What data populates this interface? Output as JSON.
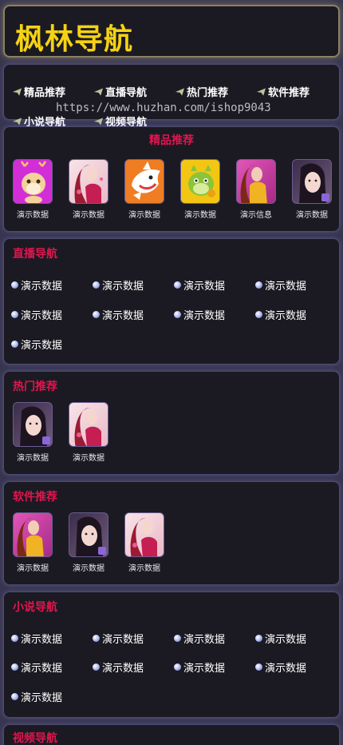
{
  "header": {
    "title": "枫林导航"
  },
  "top_nav": {
    "items": [
      "精品推荐",
      "直播导航",
      "热门推荐",
      "软件推荐",
      "小说导航",
      "视频导航"
    ]
  },
  "watermark": "https://www.huzhan.com/ishop9043",
  "featured": {
    "title": "精品推荐",
    "apps": [
      "演示数据",
      "演示数据",
      "演示数据",
      "演示数据",
      "演示信息",
      "演示数据"
    ]
  },
  "live": {
    "title": "直播导航",
    "links": [
      "演示数据",
      "演示数据",
      "演示数据",
      "演示数据",
      "演示数据",
      "演示数据",
      "演示数据",
      "演示数据",
      "演示数据"
    ]
  },
  "hot": {
    "title": "热门推荐",
    "apps": [
      "演示数据",
      "演示数据"
    ]
  },
  "software": {
    "title": "软件推荐",
    "apps": [
      "演示数据",
      "演示数据",
      "演示数据"
    ]
  },
  "novel": {
    "title": "小说导航",
    "links": [
      "演示数据",
      "演示数据",
      "演示数据",
      "演示数据",
      "演示数据",
      "演示数据",
      "演示数据",
      "演示数据",
      "演示数据"
    ]
  },
  "video": {
    "title": "视频导航"
  },
  "colors": {
    "accent": "#e0164f",
    "title_yellow": "#f5d214",
    "panel_bg": "#1b1a22",
    "page_bg": "#37354f"
  }
}
